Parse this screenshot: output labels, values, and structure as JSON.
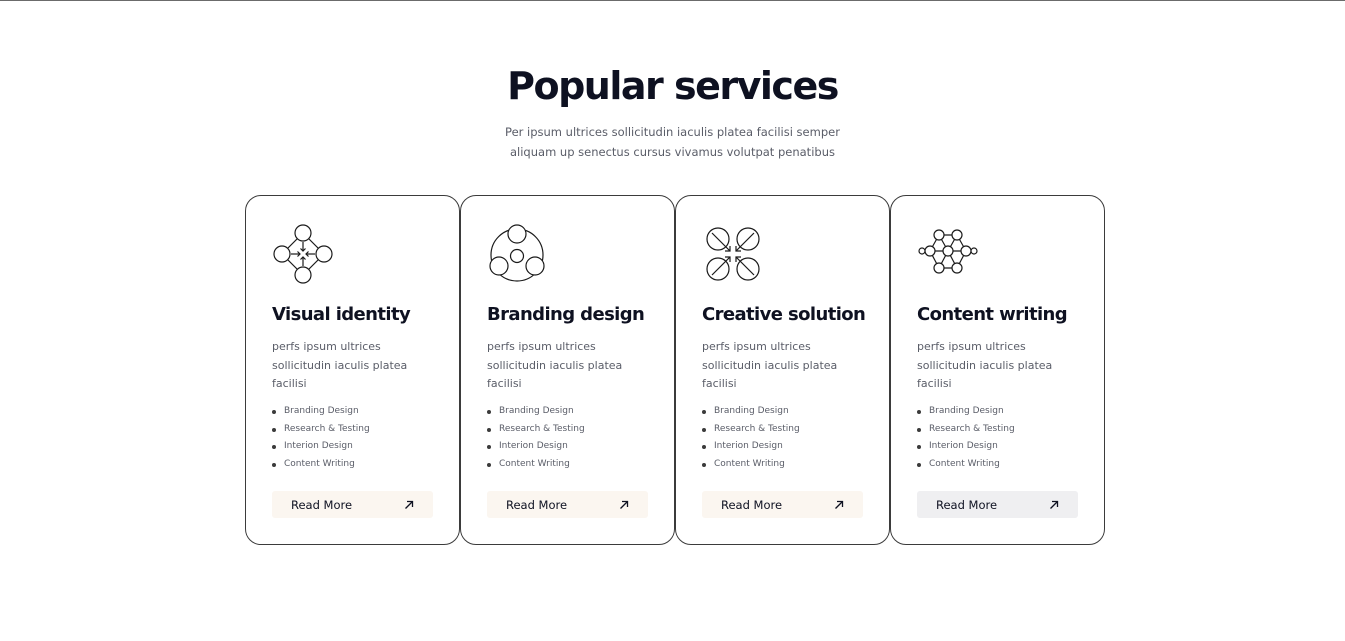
{
  "header": {
    "title": "Popular services",
    "subtitle": "Per ipsum ultrices sollicitudin iaculis platea facilisi semper aliquam up senectus cursus vivamus volutpat penatibus"
  },
  "cards": [
    {
      "icon": "four-circles-arrows-icon",
      "title": "Visual identity",
      "description": "perfs ipsum ultrices sollicitudin iaculis platea facilisi",
      "items": [
        "Branding Design",
        "Research & Testing",
        "Interion Design",
        "Content Writing"
      ],
      "button_label": "Read More"
    },
    {
      "icon": "three-circles-icon",
      "title": "Branding design",
      "description": "perfs ipsum ultrices sollicitudin iaculis platea facilisi",
      "items": [
        "Branding Design",
        "Research & Testing",
        "Interion Design",
        "Content Writing"
      ],
      "button_label": "Read More"
    },
    {
      "icon": "four-circles-inward-arrows-icon",
      "title": "Creative solution",
      "description": "perfs ipsum ultrices sollicitudin iaculis platea facilisi",
      "items": [
        "Branding Design",
        "Research & Testing",
        "Interion Design",
        "Content Writing"
      ],
      "button_label": "Read More"
    },
    {
      "icon": "network-nodes-icon",
      "title": "Content writing",
      "description": "perfs ipsum ultrices sollicitudin iaculis platea facilisi",
      "items": [
        "Branding Design",
        "Research & Testing",
        "Interion Design",
        "Content Writing"
      ],
      "button_label": "Read More"
    }
  ],
  "colors": {
    "text_dark": "#0e1121",
    "text_muted": "#5a5d68",
    "card_border": "#3b3b3b",
    "button_bg": "#fbf6f0",
    "button_bg_hover": "#efeff1"
  }
}
